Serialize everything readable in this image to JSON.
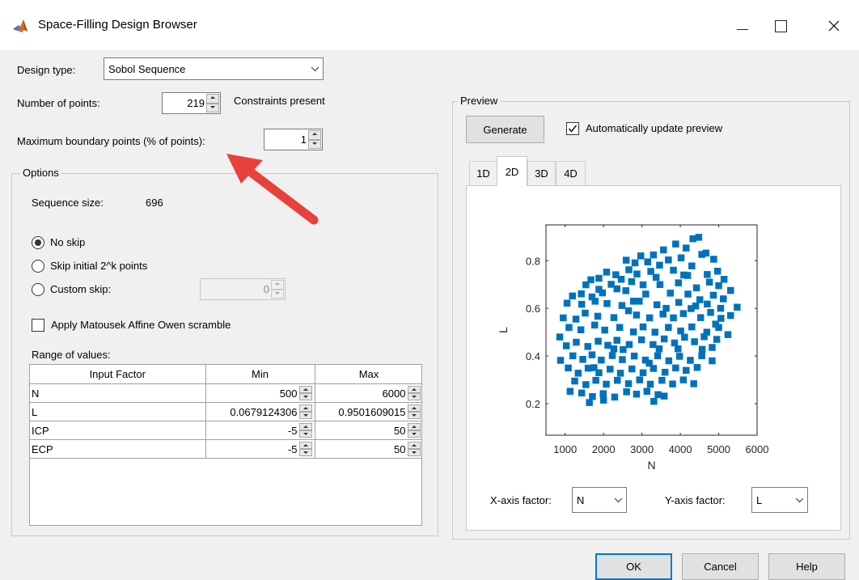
{
  "window": {
    "title": "Space-Filling Design Browser"
  },
  "design_type": {
    "label": "Design type:",
    "value": "Sobol Sequence"
  },
  "num_points": {
    "label": "Number of points:",
    "value": "219",
    "constraints_text": "Constraints present"
  },
  "max_boundary": {
    "label": "Maximum boundary points (% of points):",
    "value": "1"
  },
  "options": {
    "legend": "Options",
    "sequence_size_label": "Sequence size:",
    "sequence_size_value": "696",
    "radio_no_skip": "No skip",
    "radio_skip_initial": "Skip initial 2^k points",
    "radio_custom_skip": "Custom skip:",
    "custom_skip_value": "0",
    "selected_radio": "No skip",
    "scramble_label": "Apply Matousek Affine Owen scramble",
    "scramble_checked": false
  },
  "range": {
    "label": "Range of values:",
    "headers": [
      "Input Factor",
      "Min",
      "Max"
    ],
    "rows": [
      {
        "factor": "N",
        "min": "500",
        "max": "6000"
      },
      {
        "factor": "L",
        "min": "0.0679124306",
        "max": "0.9501609015"
      },
      {
        "factor": "ICP",
        "min": "-5",
        "max": "50"
      },
      {
        "factor": "ECP",
        "min": "-5",
        "max": "50"
      }
    ]
  },
  "preview": {
    "legend": "Preview",
    "generate_label": "Generate",
    "auto_update_label": "Automatically update preview",
    "auto_update_checked": true,
    "tabs": [
      "1D",
      "2D",
      "3D",
      "4D"
    ],
    "active_tab": "2D",
    "x_axis_factor_label": "X-axis factor:",
    "x_axis_factor_value": "N",
    "y_axis_factor_label": "Y-axis factor:",
    "y_axis_factor_value": "L"
  },
  "footer": {
    "ok_label": "OK",
    "cancel_label": "Cancel",
    "help_label": "Help"
  },
  "colors": {
    "marker": "#0072bd",
    "annotation_arrow": "#e8413c",
    "default_button_border": "#0078d7"
  },
  "chart_data": {
    "type": "scatter",
    "title": "",
    "xlabel": "N",
    "ylabel": "L",
    "xlim": [
      500,
      6000
    ],
    "ylim": [
      0.0679124306,
      0.9501609015
    ],
    "xticks": [
      1000,
      2000,
      3000,
      4000,
      5000,
      6000
    ],
    "yticks": [
      0.2,
      0.4,
      0.6,
      0.8
    ],
    "grid": false,
    "marker": "square",
    "series": [
      {
        "points": [
          [
            4330,
            0.892
          ],
          [
            4480,
            0.898
          ],
          [
            3880,
            0.87
          ],
          [
            4150,
            0.853
          ],
          [
            4670,
            0.832
          ],
          [
            3560,
            0.845
          ],
          [
            4020,
            0.812
          ],
          [
            3300,
            0.824
          ],
          [
            3690,
            0.803
          ],
          [
            4560,
            0.826
          ],
          [
            4870,
            0.806
          ],
          [
            2970,
            0.82
          ],
          [
            3150,
            0.795
          ],
          [
            2590,
            0.802
          ],
          [
            2820,
            0.791
          ],
          [
            3460,
            0.781
          ],
          [
            3820,
            0.76
          ],
          [
            4300,
            0.778
          ],
          [
            4090,
            0.74
          ],
          [
            4970,
            0.756
          ],
          [
            5140,
            0.722
          ],
          [
            5000,
            0.695
          ],
          [
            4760,
            0.71
          ],
          [
            2320,
            0.741
          ],
          [
            2080,
            0.752
          ],
          [
            2460,
            0.722
          ],
          [
            1880,
            0.726
          ],
          [
            1670,
            0.72
          ],
          [
            1540,
            0.699
          ],
          [
            2200,
            0.701
          ],
          [
            2730,
            0.712
          ],
          [
            3030,
            0.699
          ],
          [
            3370,
            0.73
          ],
          [
            3950,
            0.707
          ],
          [
            4420,
            0.686
          ],
          [
            5310,
            0.675
          ],
          [
            5120,
            0.64
          ],
          [
            4860,
            0.655
          ],
          [
            4510,
            0.636
          ],
          [
            4200,
            0.66
          ],
          [
            3740,
            0.664
          ],
          [
            3100,
            0.66
          ],
          [
            2580,
            0.674
          ],
          [
            2350,
            0.682
          ],
          [
            1970,
            0.665
          ],
          [
            1420,
            0.661
          ],
          [
            1190,
            0.652
          ],
          [
            1050,
            0.622
          ],
          [
            1430,
            0.617
          ],
          [
            1780,
            0.63
          ],
          [
            2090,
            0.62
          ],
          [
            2480,
            0.612
          ],
          [
            2930,
            0.63
          ],
          [
            3390,
            0.615
          ],
          [
            3630,
            0.6
          ],
          [
            3960,
            0.625
          ],
          [
            4280,
            0.599
          ],
          [
            4700,
            0.618
          ],
          [
            5050,
            0.6
          ],
          [
            5480,
            0.605
          ],
          [
            5310,
            0.57
          ],
          [
            5060,
            0.558
          ],
          [
            4790,
            0.583
          ],
          [
            4530,
            0.561
          ],
          [
            4080,
            0.578
          ],
          [
            3820,
            0.56
          ],
          [
            3550,
            0.576
          ],
          [
            3200,
            0.56
          ],
          [
            2860,
            0.572
          ],
          [
            2650,
            0.59
          ],
          [
            2270,
            0.561
          ],
          [
            1850,
            0.567
          ],
          [
            1520,
            0.58
          ],
          [
            1280,
            0.555
          ],
          [
            950,
            0.56
          ],
          [
            1100,
            0.52
          ],
          [
            1410,
            0.51
          ],
          [
            1770,
            0.53
          ],
          [
            2030,
            0.509
          ],
          [
            2420,
            0.52
          ],
          [
            2780,
            0.501
          ],
          [
            3030,
            0.522
          ],
          [
            3340,
            0.5
          ],
          [
            3690,
            0.52
          ],
          [
            4010,
            0.505
          ],
          [
            4300,
            0.522
          ],
          [
            4690,
            0.5
          ],
          [
            5000,
            0.52
          ],
          [
            5240,
            0.49
          ],
          [
            4950,
            0.47
          ],
          [
            4620,
            0.481
          ],
          [
            4370,
            0.46
          ],
          [
            4110,
            0.479
          ],
          [
            3850,
            0.455
          ],
          [
            3580,
            0.472
          ],
          [
            3290,
            0.448
          ],
          [
            2990,
            0.468
          ],
          [
            2670,
            0.448
          ],
          [
            2350,
            0.466
          ],
          [
            2110,
            0.445
          ],
          [
            1860,
            0.462
          ],
          [
            1590,
            0.44
          ],
          [
            1290,
            0.458
          ],
          [
            1030,
            0.443
          ],
          [
            860,
            0.48
          ],
          [
            880,
            0.382
          ],
          [
            1200,
            0.401
          ],
          [
            1460,
            0.386
          ],
          [
            1700,
            0.405
          ],
          [
            1940,
            0.383
          ],
          [
            2230,
            0.402
          ],
          [
            2490,
            0.385
          ],
          [
            2800,
            0.4
          ],
          [
            3090,
            0.383
          ],
          [
            3410,
            0.401
          ],
          [
            3700,
            0.38
          ],
          [
            3980,
            0.399
          ],
          [
            4260,
            0.382
          ],
          [
            4560,
            0.401
          ],
          [
            4830,
            0.38
          ],
          [
            4440,
            0.352
          ],
          [
            4150,
            0.34
          ],
          [
            3880,
            0.35
          ],
          [
            3600,
            0.332
          ],
          [
            3300,
            0.348
          ],
          [
            3030,
            0.33
          ],
          [
            2740,
            0.346
          ],
          [
            2440,
            0.328
          ],
          [
            2170,
            0.345
          ],
          [
            1880,
            0.33
          ],
          [
            1600,
            0.349
          ],
          [
            1340,
            0.328
          ],
          [
            1080,
            0.35
          ],
          [
            1250,
            0.295
          ],
          [
            1540,
            0.28
          ],
          [
            1800,
            0.298
          ],
          [
            2070,
            0.282
          ],
          [
            2360,
            0.298
          ],
          [
            2650,
            0.284
          ],
          [
            2940,
            0.3
          ],
          [
            3220,
            0.282
          ],
          [
            3520,
            0.298
          ],
          [
            3800,
            0.283
          ],
          [
            4080,
            0.3
          ],
          [
            4350,
            0.284
          ],
          [
            2600,
            0.25
          ],
          [
            2860,
            0.24
          ],
          [
            3130,
            0.252
          ],
          [
            3420,
            0.238
          ],
          [
            2290,
            0.228
          ],
          [
            1990,
            0.242
          ],
          [
            1710,
            0.23
          ],
          [
            1430,
            0.245
          ],
          [
            1130,
            0.252
          ],
          [
            1630,
            0.205
          ],
          [
            2000,
            0.215
          ],
          [
            3310,
            0.21
          ],
          [
            3580,
            0.232
          ],
          [
            4570,
            0.428
          ],
          [
            2510,
            0.427
          ],
          [
            1750,
            0.351
          ],
          [
            3190,
            0.37
          ],
          [
            4700,
            0.742
          ],
          [
            4190,
            0.738
          ],
          [
            3470,
            0.7
          ],
          [
            3230,
            0.755
          ],
          [
            2870,
            0.744
          ],
          [
            2660,
            0.762
          ],
          [
            1880,
            0.68
          ],
          [
            1700,
            0.648
          ],
          [
            2780,
            0.63
          ],
          [
            4400,
            0.61
          ],
          [
            4920,
            0.534
          ],
          [
            2270,
            0.43
          ],
          [
            3940,
            0.43
          ],
          [
            3450,
            0.43
          ],
          [
            4830,
            0.436
          ]
        ]
      }
    ]
  }
}
